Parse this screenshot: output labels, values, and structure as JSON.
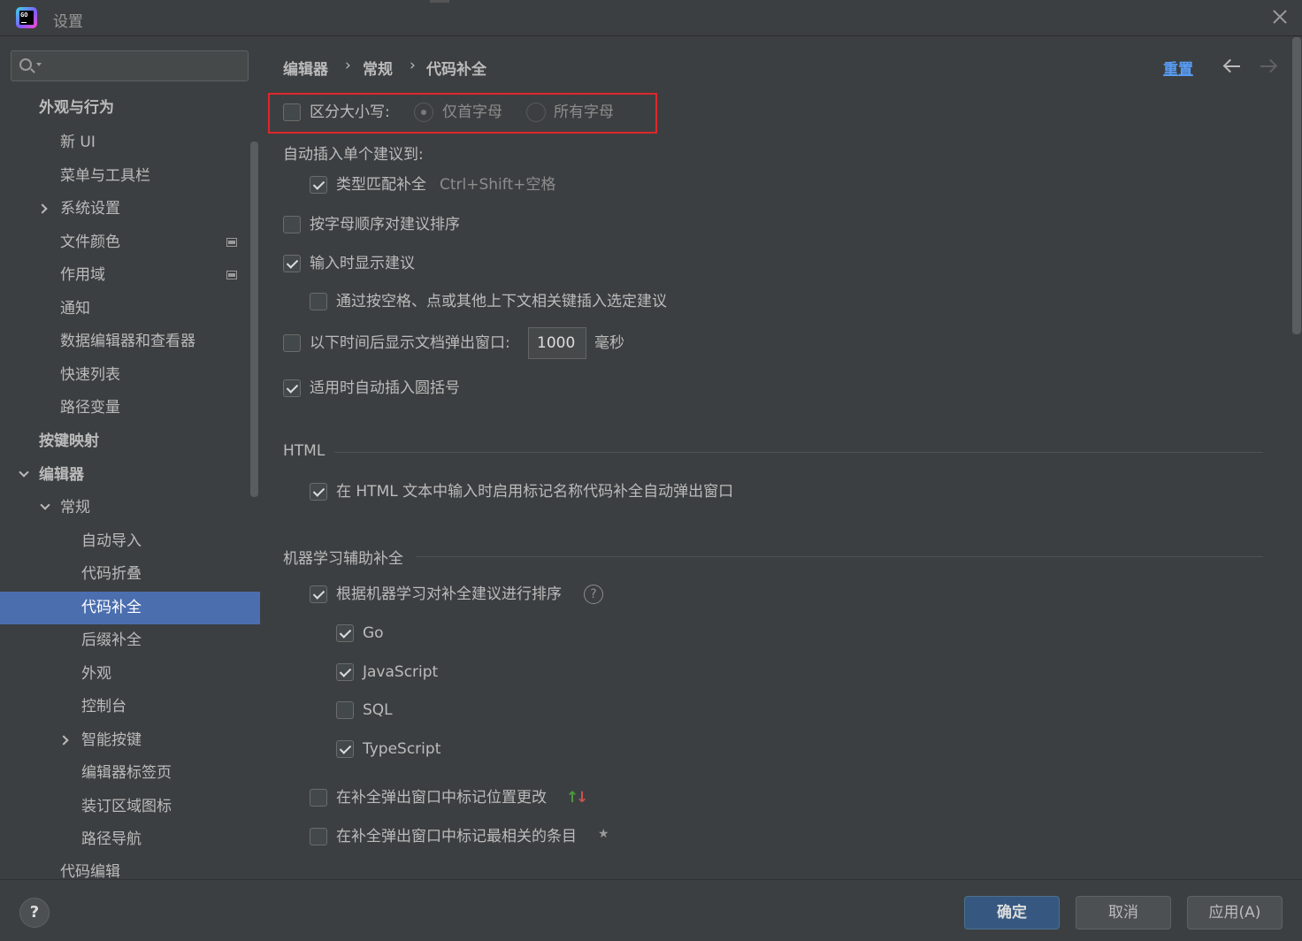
{
  "window": {
    "title": "设置"
  },
  "search": {
    "placeholder": ""
  },
  "sidebar": {
    "items": [
      {
        "label": "外观与行为"
      },
      {
        "label": "新 UI"
      },
      {
        "label": "菜单与工具栏"
      },
      {
        "label": "系统设置"
      },
      {
        "label": "文件颜色"
      },
      {
        "label": "作用域"
      },
      {
        "label": "通知"
      },
      {
        "label": "数据编辑器和查看器"
      },
      {
        "label": "快速列表"
      },
      {
        "label": "路径变量"
      },
      {
        "label": "按键映射"
      },
      {
        "label": "编辑器"
      },
      {
        "label": "常规"
      },
      {
        "label": "自动导入"
      },
      {
        "label": "代码折叠"
      },
      {
        "label": "代码补全"
      },
      {
        "label": "后缀补全"
      },
      {
        "label": "外观"
      },
      {
        "label": "控制台"
      },
      {
        "label": "智能按键"
      },
      {
        "label": "编辑器标签页"
      },
      {
        "label": "装订区域图标"
      },
      {
        "label": "路径导航"
      },
      {
        "label": "代码编辑"
      }
    ]
  },
  "header": {
    "breadcrumb": [
      "编辑器",
      "›",
      "常规",
      "›",
      "代码补全"
    ],
    "reset_label": "重置"
  },
  "settings": {
    "case_sensitive": {
      "label": "区分大小写:",
      "checked": false,
      "option_first": "仅首字母",
      "option_all": "所有字母"
    },
    "auto_insert_title": "自动插入单个建议到:",
    "type_match": {
      "label": "类型匹配补全",
      "shortcut": "Ctrl+Shift+空格",
      "checked": true
    },
    "sort_alpha": {
      "label": "按字母顺序对建议排序",
      "checked": false
    },
    "show_suggestions": {
      "label": "输入时显示建议",
      "checked": true
    },
    "insert_on_keys": {
      "label": "通过按空格、点或其他上下文相关键插入选定建议",
      "checked": false
    },
    "doc_popup": {
      "label": "以下时间后显示文档弹出窗口:",
      "value": "1000",
      "unit": "毫秒",
      "checked": false
    },
    "auto_parens": {
      "label": "适用时自动插入圆括号",
      "checked": true
    }
  },
  "html_section": {
    "title": "HTML",
    "tag_completion": {
      "label": "在 HTML 文本中输入时启用标记名称代码补全自动弹出窗口",
      "checked": true
    }
  },
  "ml_section": {
    "title": "机器学习辅助补全",
    "sort_ml": {
      "label": "根据机器学习对补全建议进行排序",
      "checked": true
    },
    "help_icon": "?",
    "languages": [
      {
        "label": "Go",
        "checked": true
      },
      {
        "label": "JavaScript",
        "checked": true
      },
      {
        "label": "SQL",
        "checked": false
      },
      {
        "label": "TypeScript",
        "checked": true
      }
    ],
    "mark_position": {
      "label": "在补全弹出窗口中标记位置更改",
      "checked": false
    },
    "mark_relevant": {
      "label": "在补全弹出窗口中标记最相关的条目",
      "checked": false
    }
  },
  "footer": {
    "help_label": "?",
    "ok_label": "确定",
    "cancel_label": "取消",
    "apply_label": "应用(A)"
  },
  "colors": {
    "background": "#3c3f41",
    "selection": "#4b6eaf",
    "link": "#589df6",
    "highlight_box": "#e0262b",
    "primary_button": "#365880"
  }
}
